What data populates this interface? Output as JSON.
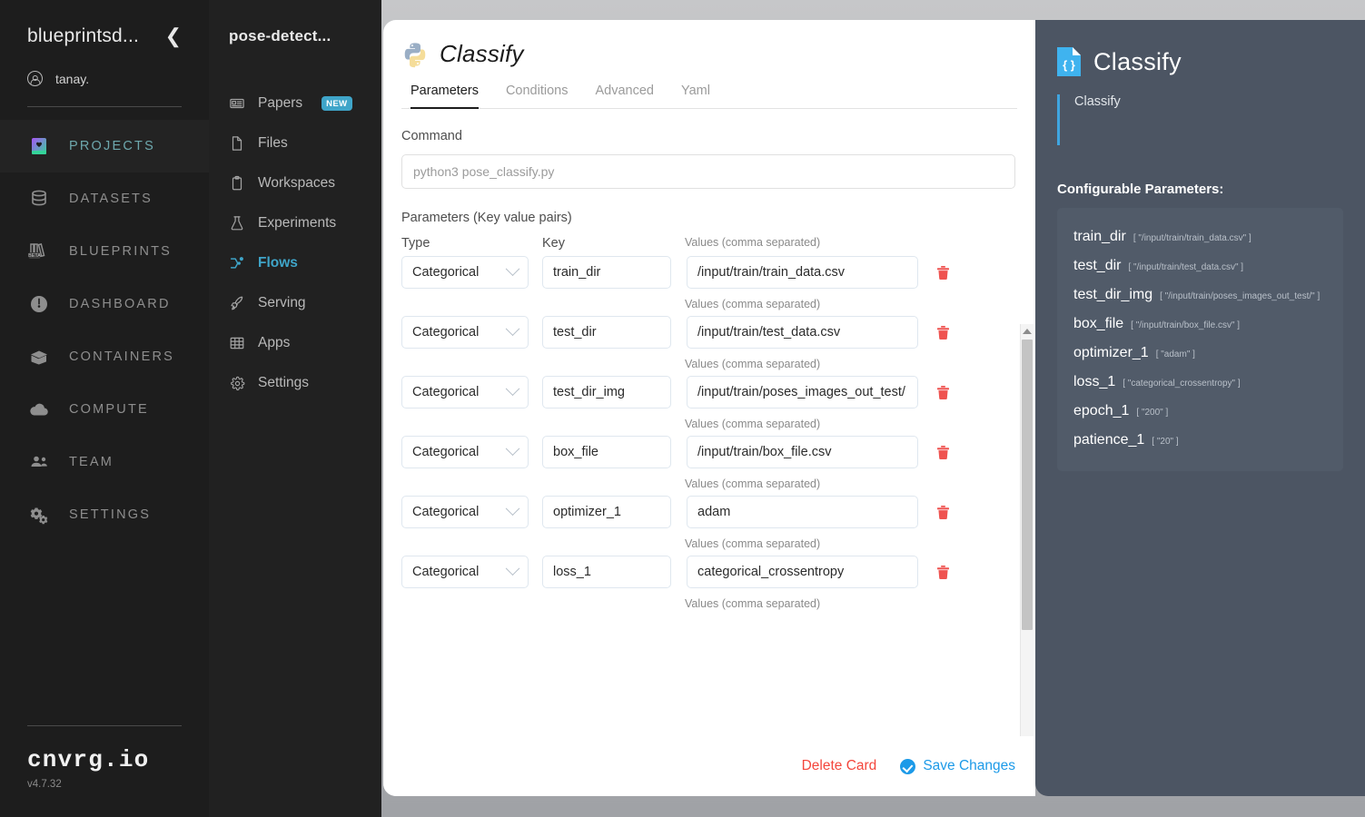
{
  "sidebar_primary": {
    "org_name": "blueprintsd...",
    "collapse_icon": "chevron-left-icon",
    "user_name": "tanay.",
    "items": [
      {
        "label": "PROJECTS",
        "icon": "book-heart-icon",
        "active": true,
        "badge": ""
      },
      {
        "label": "DATASETS",
        "icon": "database-icon",
        "active": false,
        "badge": ""
      },
      {
        "label": "BLUEPRINTS",
        "icon": "books-icon",
        "active": false,
        "badge": "BETA"
      },
      {
        "label": "DASHBOARD",
        "icon": "gauge-icon",
        "active": false,
        "badge": ""
      },
      {
        "label": "CONTAINERS",
        "icon": "box-icon",
        "active": false,
        "badge": ""
      },
      {
        "label": "COMPUTE",
        "icon": "cloud-icon",
        "active": false,
        "badge": ""
      },
      {
        "label": "TEAM",
        "icon": "people-icon",
        "active": false,
        "badge": ""
      },
      {
        "label": "SETTINGS",
        "icon": "gears-icon",
        "active": false,
        "badge": ""
      }
    ],
    "brand": "cnvrg.io",
    "version": "v4.7.32"
  },
  "sidebar_secondary": {
    "project_name": "pose-detect...",
    "items": [
      {
        "label": "Papers",
        "icon": "news-icon",
        "active": false,
        "badge": "NEW"
      },
      {
        "label": "Files",
        "icon": "file-icon",
        "active": false,
        "badge": ""
      },
      {
        "label": "Workspaces",
        "icon": "clipboard-icon",
        "active": false,
        "badge": ""
      },
      {
        "label": "Experiments",
        "icon": "flask-icon",
        "active": false,
        "badge": ""
      },
      {
        "label": "Flows",
        "icon": "flow-icon",
        "active": true,
        "badge": ""
      },
      {
        "label": "Serving",
        "icon": "rocket-icon",
        "active": false,
        "badge": ""
      },
      {
        "label": "Apps",
        "icon": "grid-icon",
        "active": false,
        "badge": ""
      },
      {
        "label": "Settings",
        "icon": "gear-icon",
        "active": false,
        "badge": ""
      }
    ]
  },
  "card": {
    "title": "Classify",
    "icon": "python-icon",
    "tabs": [
      {
        "label": "Parameters",
        "active": true
      },
      {
        "label": "Conditions",
        "active": false
      },
      {
        "label": "Advanced",
        "active": false
      },
      {
        "label": "Yaml",
        "active": false
      }
    ],
    "command_label": "Command",
    "command_placeholder": "python3 pose_classify.py",
    "command_value": "",
    "params_section_label": "Parameters (Key value pairs)",
    "col_type": "Type",
    "col_key": "Key",
    "col_values": "Values (comma separated)",
    "rows": [
      {
        "type": "Categorical",
        "key": "train_dir",
        "value": "/input/train/train_data.csv"
      },
      {
        "type": "Categorical",
        "key": "test_dir",
        "value": "/input/train/test_data.csv"
      },
      {
        "type": "Categorical",
        "key": "test_dir_img",
        "value": "/input/train/poses_images_out_test/"
      },
      {
        "type": "Categorical",
        "key": "box_file",
        "value": "/input/train/box_file.csv"
      },
      {
        "type": "Categorical",
        "key": "optimizer_1",
        "value": "adam"
      },
      {
        "type": "Categorical",
        "key": "loss_1",
        "value": "categorical_crossentropy"
      }
    ],
    "trailing_values_label": "Values (comma separated)",
    "delete_label": "Delete Card",
    "save_label": "Save Changes"
  },
  "right_panel": {
    "icon": "json-file-icon",
    "title": "Classify",
    "description": "Classify",
    "section_title": "Configurable Parameters:",
    "parameters": [
      {
        "name": "train_dir",
        "value": "[ \"/input/train/train_data.csv\" ]"
      },
      {
        "name": "test_dir",
        "value": "[ \"/input/train/test_data.csv\" ]"
      },
      {
        "name": "test_dir_img",
        "value": "[ \"/input/train/poses_images_out_test/\" ]"
      },
      {
        "name": "box_file",
        "value": "[ \"/input/train/box_file.csv\" ]"
      },
      {
        "name": "optimizer_1",
        "value": "[ \"adam\" ]"
      },
      {
        "name": "loss_1",
        "value": "[ \"categorical_crossentropy\" ]"
      },
      {
        "name": "epoch_1",
        "value": "[ \"200\" ]"
      },
      {
        "name": "patience_1",
        "value": "[ \"20\" ]"
      }
    ]
  },
  "colors": {
    "accent_blue": "#3fa5c9",
    "danger_red": "#f4463c",
    "save_blue": "#1c9ae8",
    "panel_slate": "#4c5563",
    "sidebar_dark": "#1d1d1d"
  }
}
